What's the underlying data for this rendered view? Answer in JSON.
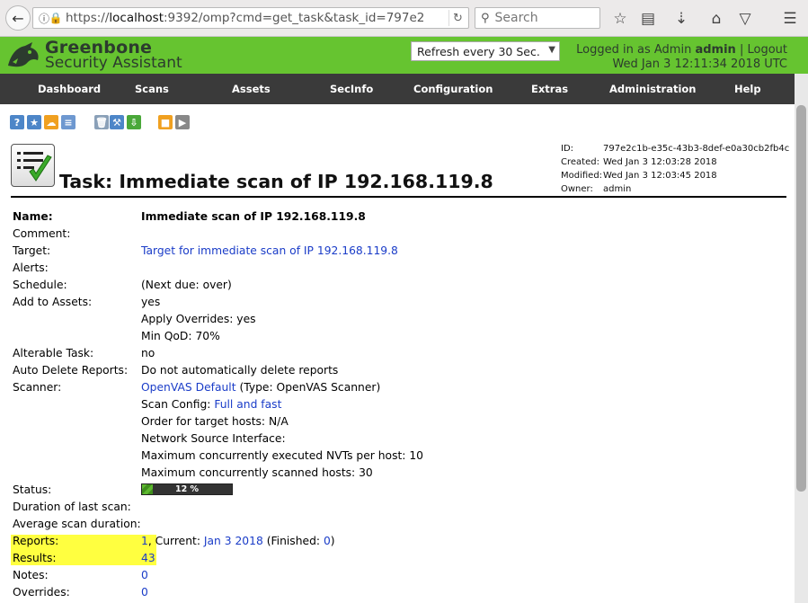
{
  "browser": {
    "url_prefix": "https://",
    "url_host": "localhost",
    "url_rest": ":9392/omp?cmd=get_task&task_id=797e2",
    "search_placeholder": "Search"
  },
  "header": {
    "brand_line1": "Greenbone",
    "brand_line2": "Security Assistant",
    "refresh_option": "Refresh every 30 Sec.",
    "logged_in_as": "Logged in as",
    "role": "Admin",
    "username": "admin",
    "separator": "|",
    "logout": "Logout",
    "datetime": "Wed Jan 3 12:11:34 2018 UTC"
  },
  "menu": [
    "Dashboard",
    "Scans",
    "Assets",
    "SecInfo",
    "Configuration",
    "Extras",
    "Administration",
    "Help"
  ],
  "task": {
    "title": "Task: Immediate scan of IP 192.168.119.8",
    "meta": {
      "id_label": "ID:",
      "id": "797e2c1b-e35c-43b3-8def-e0a30cb2fb4c",
      "created_label": "Created:",
      "created": "Wed Jan 3 12:03:28 2018",
      "modified_label": "Modified:",
      "modified": "Wed Jan 3 12:03:45 2018",
      "owner_label": "Owner:",
      "owner": "admin"
    },
    "labels": {
      "name": "Name:",
      "comment": "Comment:",
      "target": "Target:",
      "alerts": "Alerts:",
      "schedule": "Schedule:",
      "add_to_assets": "Add to Assets:",
      "alterable": "Alterable Task:",
      "auto_delete": "Auto Delete Reports:",
      "scanner": "Scanner:",
      "status": "Status:",
      "duration_last": "Duration of last scan:",
      "avg_duration": "Average scan duration:",
      "reports": "Reports:",
      "results": "Results:",
      "notes": "Notes:",
      "overrides": "Overrides:"
    },
    "name": "Immediate scan of IP 192.168.119.8",
    "target": "Target for immediate scan of IP 192.168.119.8",
    "schedule": "(Next due: over)",
    "add_to_assets": "yes",
    "apply_overrides": "Apply Overrides: yes",
    "min_qod": "Min QoD: 70%",
    "alterable": "no",
    "auto_delete": "Do not automatically delete reports",
    "scanner_name": "OpenVAS Default",
    "scanner_type": " (Type: OpenVAS Scanner)",
    "scan_config_label": "Scan Config: ",
    "scan_config": "Full and fast",
    "order_hosts": "Order for target hosts: N/A",
    "net_source_iface": "Network Source Interface:",
    "max_nvts": "Maximum concurrently executed NVTs per host: 10",
    "max_hosts": "Maximum concurrently scanned hosts: 30",
    "status_progress": 12,
    "status_text": "12 %",
    "reports_count": "1",
    "reports_sep": ", Current: ",
    "reports_current": "Jan 3 2018",
    "reports_finished_open": " (Finished: ",
    "reports_finished": "0",
    "reports_finished_close": ")",
    "results": "43",
    "notes": "0",
    "overrides": "0"
  }
}
